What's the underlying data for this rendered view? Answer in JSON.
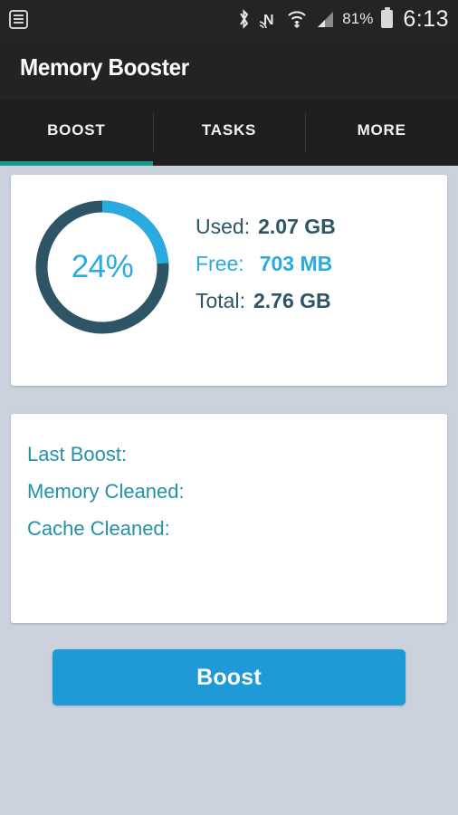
{
  "status_bar": {
    "notification_icon": "list-notification-icon",
    "icons": [
      "bluetooth-icon",
      "nfc-icon",
      "wifi-icon",
      "signal-icon"
    ],
    "battery_percent": "81%",
    "battery_icon": "battery-icon",
    "time": "6:13"
  },
  "app_bar": {
    "title": "Memory Booster"
  },
  "tabs": [
    {
      "label": "BOOST",
      "active": true
    },
    {
      "label": "TASKS",
      "active": false
    },
    {
      "label": "MORE",
      "active": false
    }
  ],
  "memory_card": {
    "gauge": {
      "percent_label": "24%",
      "percent_value": 24,
      "arc_color": "#29abe2",
      "track_color": "#2d5566"
    },
    "rows": [
      {
        "key": "Used:",
        "value": "2.07 GB"
      },
      {
        "key": "Free:",
        "value": "703 MB"
      },
      {
        "key": "Total:",
        "value": "2.76 GB"
      }
    ]
  },
  "stats_card": {
    "rows": [
      {
        "key": "Last Boost:",
        "value": ""
      },
      {
        "key": "Memory Cleaned:",
        "value": ""
      },
      {
        "key": "Cache Cleaned:",
        "value": ""
      }
    ]
  },
  "actions": {
    "boost_label": "Boost"
  },
  "colors": {
    "page_background": "#cbd1dd",
    "app_bar": "#232323",
    "tab_bar": "#1f1f1f",
    "tab_indicator": "#17998c",
    "accent_blue": "#29abe2",
    "button_blue": "#1e9ad6",
    "dark_slate": "#2d5566",
    "teal_text": "#2491aa"
  }
}
